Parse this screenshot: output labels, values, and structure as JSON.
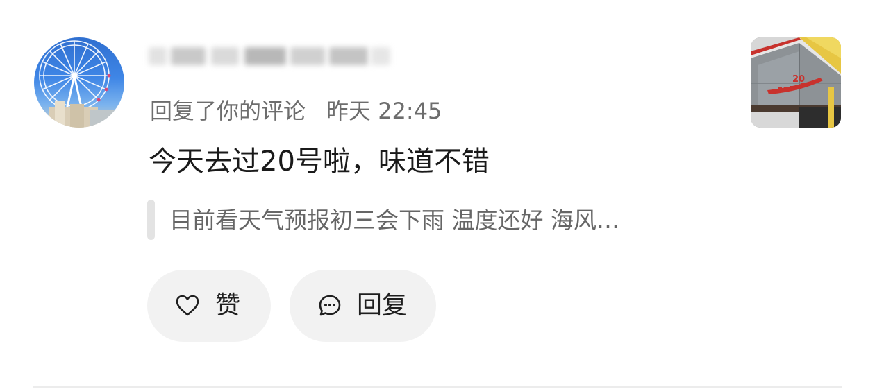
{
  "comment": {
    "action_text": "回复了你的评论",
    "time": "昨天 22:45",
    "content": "今天去过20号啦，味道不错",
    "quoted": "目前看天气预报初三会下雨 温度还好 海风…"
  },
  "actions": {
    "like_label": "赞",
    "reply_label": "回复"
  },
  "thumbnail": {
    "sign_text": "20"
  },
  "icons": {
    "like": "heart-outline-icon",
    "reply": "chat-bubble-dots-icon"
  },
  "colors": {
    "pill_bg": "#f2f2f2",
    "meta_text": "#6d6d6d",
    "body_text": "#1a1a1a",
    "quote_text": "#666666",
    "accent_red": "#c8322d"
  }
}
